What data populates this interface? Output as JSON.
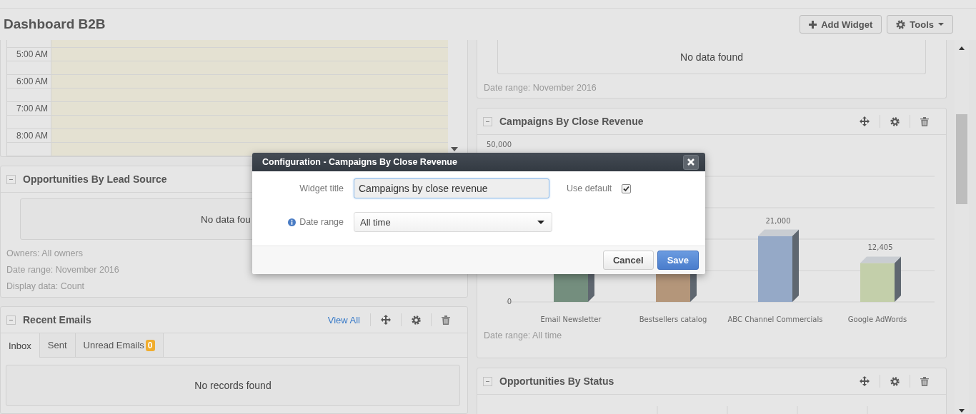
{
  "page_title": "Dashboard B2B",
  "toolbar": [
    {
      "label": "Add Widget",
      "kind": "plus"
    },
    {
      "label": "Tools",
      "kind": "gear-menu"
    }
  ],
  "calendar": {
    "times": [
      "5:00 AM",
      "6:00 AM",
      "7:00 AM",
      "8:00 AM"
    ]
  },
  "lead_source": {
    "title": "Opportunities By Lead Source",
    "empty_text": "No data fou",
    "meta": [
      "Owners: All owners",
      "Date range: November 2016",
      "Display data: Count"
    ]
  },
  "recent_emails": {
    "title": "Recent Emails",
    "view_all": "View All",
    "tabs": [
      {
        "label": "Inbox",
        "selected": true
      },
      {
        "label": "Sent",
        "selected": false
      },
      {
        "label": "Unread Emails",
        "badge": "0",
        "selected": false
      }
    ],
    "empty_text": "No records found"
  },
  "top_right": {
    "empty_text": "No data found",
    "date_range": "Date range: November 2016"
  },
  "campaigns": {
    "title": "Campaigns By Close Revenue",
    "date_range": "Date range: All time",
    "chart_data": {
      "type": "bar",
      "categories": [
        "Email Newsletter",
        "Bestsellers catalog",
        "ABC Channel Commercials",
        "Google AdWords"
      ],
      "values": [
        null,
        null,
        21000,
        12405
      ],
      "value_labels": [
        null,
        null,
        "21,000",
        "12,405"
      ],
      "colors": [
        "#748e7e",
        "#b4967a",
        "#95a9c7",
        "#c3cfaa"
      ],
      "ylim": [
        0,
        50000
      ],
      "yticks": [
        {
          "value": 0,
          "label": "0"
        },
        {
          "value": 50000,
          "label": "50,000"
        }
      ]
    }
  },
  "status": {
    "title": "Opportunities By Status"
  },
  "modal": {
    "title": "Configuration - Campaigns By Close Revenue",
    "widget_title_label": "Widget title",
    "widget_title_value": "Campaigns by close revenue",
    "use_default": {
      "label": "Use default",
      "checked": true
    },
    "date_range_label": "Date range",
    "date_range_value": "All time",
    "buttons": [
      {
        "label": "Cancel",
        "kind": "default"
      },
      {
        "label": "Save",
        "kind": "primary"
      }
    ]
  }
}
